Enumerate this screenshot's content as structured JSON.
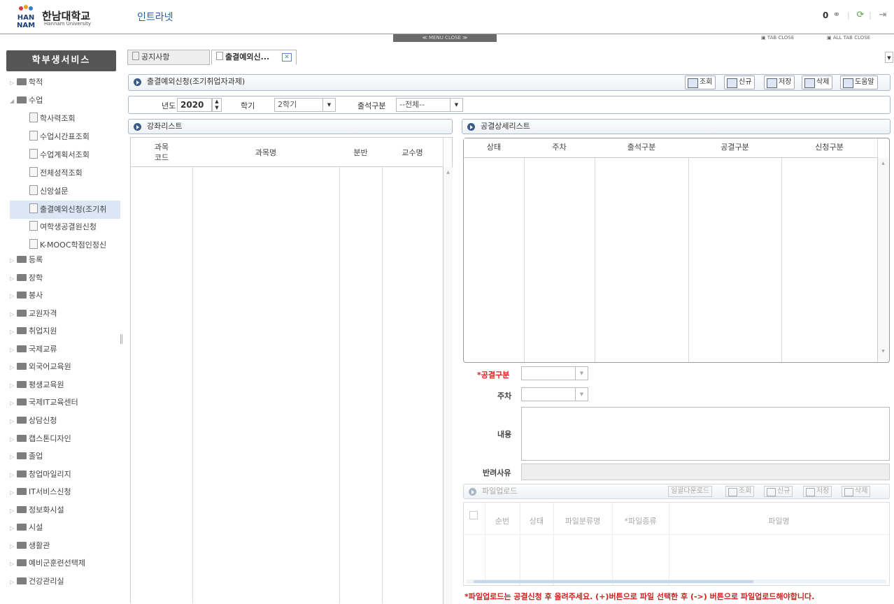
{
  "header": {
    "logo_text": "한남대학교",
    "logo_sub": "Hannam University",
    "logo_mark": "HAN NAM",
    "intranet": "인트라넷",
    "count": "0",
    "icons": [
      "link-icon",
      "refresh-icon",
      "logout-icon"
    ]
  },
  "bar": {
    "menu_close": "≪ MENU CLOSE ≫",
    "tab_close": "▣ TAB CLOSE",
    "all_tab_close": "▣ ALL TAB CLOSE"
  },
  "sidebar": {
    "title": "학부생서비스",
    "items_top": [
      {
        "label": "학적",
        "arrow": "▷"
      },
      {
        "label": "수업",
        "arrow": "◢"
      }
    ],
    "sub_items": [
      {
        "label": "학사력조회"
      },
      {
        "label": "수업시간표조회"
      },
      {
        "label": "수업계획서조회"
      },
      {
        "label": "전체성적조회"
      },
      {
        "label": "신앙설문"
      },
      {
        "label": "출결예외신청(조기취"
      },
      {
        "label": "여학생공결원신청"
      },
      {
        "label": "K-MOOC학점인정신"
      }
    ],
    "items_bottom": [
      {
        "label": "등록"
      },
      {
        "label": "장학"
      },
      {
        "label": "봉사"
      },
      {
        "label": "교원자격"
      },
      {
        "label": "취업지원"
      },
      {
        "label": "국제교류"
      },
      {
        "label": "외국어교육원"
      },
      {
        "label": "평생교육원"
      },
      {
        "label": "국제IT교육센터"
      },
      {
        "label": "상담신청"
      },
      {
        "label": "캡스톤디자인"
      },
      {
        "label": "졸업"
      },
      {
        "label": "창업마일리지"
      },
      {
        "label": "IT서비스신청"
      },
      {
        "label": "정보화시설"
      },
      {
        "label": "시설"
      },
      {
        "label": "생활관"
      },
      {
        "label": "예비군훈련선택제"
      },
      {
        "label": "건강관리실"
      }
    ]
  },
  "tabs": [
    {
      "label": "공지사항"
    },
    {
      "label": "출결예외신..."
    }
  ],
  "page": {
    "title": "출결예외신청(조기취업자과제)",
    "buttons": [
      "조회",
      "신규",
      "저장",
      "삭제",
      "도움말"
    ],
    "search": {
      "year_label": "년도",
      "year_value": "2020",
      "semester_label": "학기",
      "semester_value": "2학기",
      "attend_label": "출석구분",
      "attend_value": "--전체--"
    }
  },
  "lecture_list": {
    "title": "강좌리스트",
    "columns": [
      "과목\n코드",
      "과목명",
      "분반",
      "교수명"
    ]
  },
  "detail_list": {
    "title": "공결상세리스트",
    "columns": [
      "상태",
      "주차",
      "출석구분",
      "공결구분",
      "신청구분"
    ]
  },
  "form": {
    "type_label": "*공결구분",
    "week_label": "주차",
    "content_label": "내용",
    "reject_label": "반려사유"
  },
  "upload": {
    "title": "파일업로드",
    "buttons": [
      "일괄다운로드",
      "조회",
      "신규",
      "저장",
      "삭제"
    ],
    "columns": [
      "순번",
      "상태",
      "파일분류명",
      "*파일종류",
      "파일명"
    ],
    "notice": "*파일업로드는 공결신청 후 올려주세요.  (+)버튼으로 파일 선택한 후 (->) 버튼으로 파일업로드해야합니다."
  }
}
